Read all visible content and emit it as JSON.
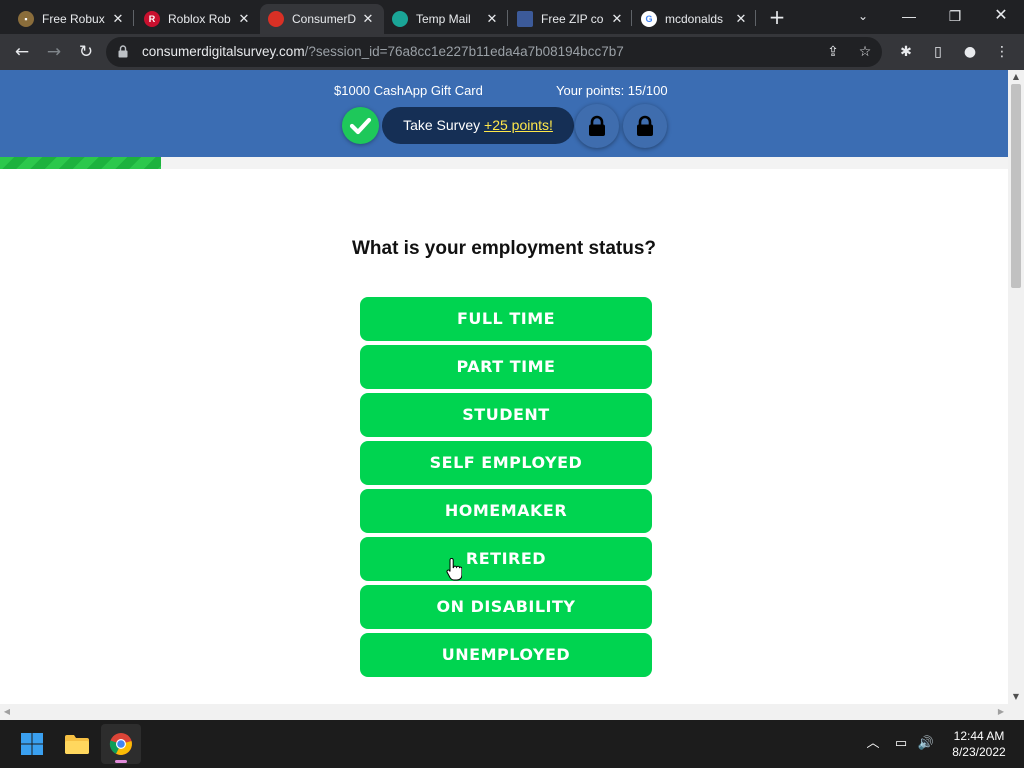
{
  "browser": {
    "tabs": [
      {
        "title": "Free Robux",
        "icon": "gift-favicon",
        "color": "#8a6d3b"
      },
      {
        "title": "Roblox Rob",
        "icon": "roblox-favicon",
        "color": "#c8102e"
      },
      {
        "title": "ConsumerD",
        "icon": "survey-favicon",
        "color": "#d93025",
        "active": true
      },
      {
        "title": "Temp Mail",
        "icon": "tempmail-favicon",
        "color": "#1aa597"
      },
      {
        "title": "Free ZIP co",
        "icon": "flag-favicon",
        "color": "#3c5a99"
      },
      {
        "title": "mcdonalds",
        "icon": "google-favicon",
        "color": "#4285f4"
      }
    ],
    "url_host": "consumerdigitalsurvey.com",
    "url_path": "/?session_id=76a8cc1e227b11eda4a7b08194bcc7b7"
  },
  "page": {
    "prize": "$1000 CashApp Gift Card",
    "points": "Your points: 15/100",
    "progress_fraction": 0.16,
    "take_survey": "Take Survey",
    "take_survey_points": "+25 points!",
    "question": "What is your employment status?",
    "options": [
      "FULL TIME",
      "PART TIME",
      "STUDENT",
      "SELF EMPLOYED",
      "HOMEMAKER",
      "RETIRED",
      "ON DISABILITY",
      "UNEMPLOYED"
    ],
    "accent_green": "#00d450",
    "banner_blue": "#3b6db3"
  },
  "taskbar": {
    "time": "12:44 AM",
    "date": "8/23/2022"
  }
}
